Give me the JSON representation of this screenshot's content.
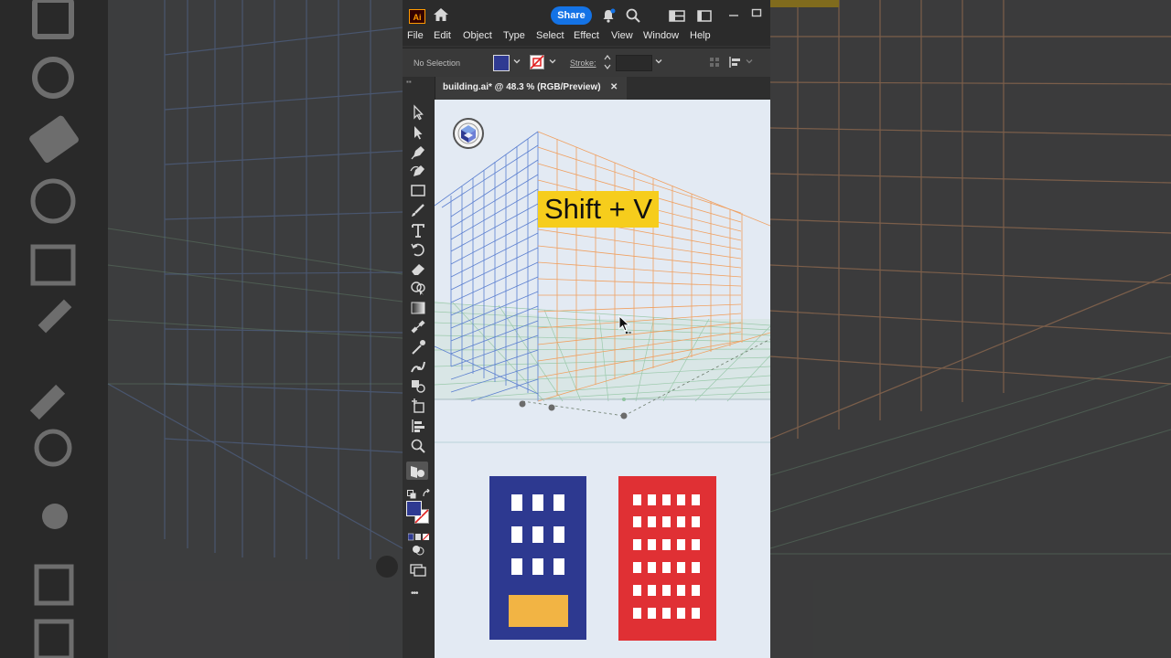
{
  "app": {
    "logo_text": "Ai",
    "share_label": "Share",
    "menu": [
      "File",
      "Edit",
      "Object",
      "Type",
      "Select",
      "Effect",
      "View",
      "Window",
      "Help"
    ],
    "control": {
      "selection_label": "No Selection",
      "fill_color": "#2f3a92",
      "stroke_label": "Stroke:"
    },
    "document_tab": {
      "label": "building.ai* @ 48.3 % (RGB/Preview)",
      "close": "✕"
    },
    "tools": [
      "selection-tool",
      "direct-selection-tool",
      "pen-tool",
      "curvature-tool",
      "rectangle-tool",
      "paintbrush-tool",
      "type-tool",
      "rotate-tool",
      "eraser-tool",
      "shape-builder-tool",
      "gradient-tool",
      "blend-tool",
      "eyedropper-tool",
      "puppet-warp-tool",
      "live-paint-tool",
      "artboard-tool",
      "column-graph-tool",
      "zoom-tool",
      "perspective-grid-tool"
    ],
    "more_tools": "•••"
  },
  "overlay": {
    "shortcut_text": "Shift + V"
  },
  "colors": {
    "blue_building": "#2d3990",
    "red_building": "#e03034",
    "door": "#f2b444",
    "grid_left": "#5b7fd0",
    "grid_right": "#f0a060",
    "grid_floor": "#8fc49f",
    "accent": "#1473e6",
    "highlight": "#f6cd1c"
  }
}
